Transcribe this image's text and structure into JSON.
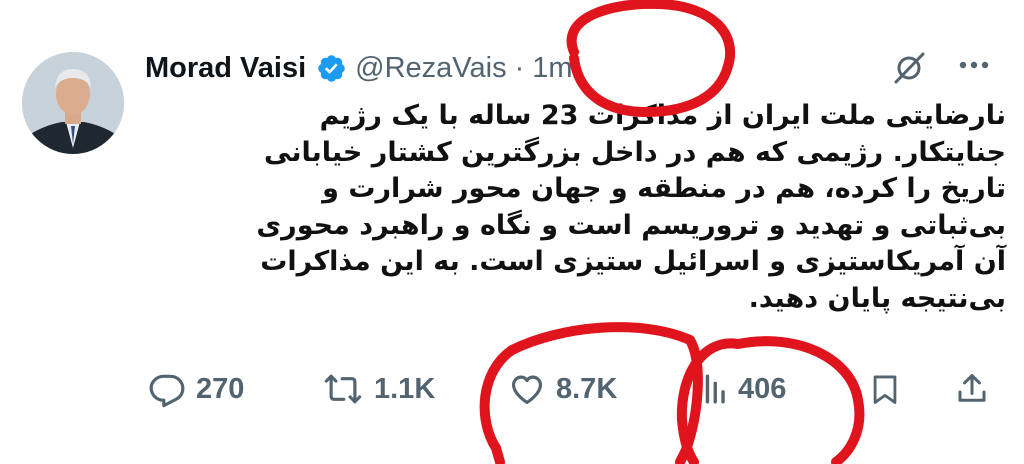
{
  "tweet": {
    "author_name": "Morad Vaisi",
    "handle": "@RezaVais",
    "separator": "·",
    "time": "1m",
    "text": "نارضایتی ملت ایران از مذاکرات 23 ساله با یک رژیم\nجنایتکار. رژیمی که هم در داخل بزرگترین کشتار خیابانی\nتاریخ را کرده، هم در منطقه و جهان محور شرارت و\nبی‌ثباتی و تهدید و تروریسم است و نگاه و راهبرد محوری\nآن آمریکاستیزی و اسرائیل ستیزی است. به این مذاکرات\nبی‌نتیجه پایان دهید."
  },
  "actions": {
    "replies": "270",
    "reposts": "1.1K",
    "likes": "8.7K",
    "views": "406"
  },
  "icons": {
    "verified": "verified-badge-icon",
    "grok": "grok-icon",
    "more": "more-icon",
    "reply": "reply-icon",
    "repost": "repost-icon",
    "like": "heart-icon",
    "views": "views-icon",
    "bookmark": "bookmark-icon",
    "share": "share-icon"
  },
  "colors": {
    "verified": "#1d9bf0",
    "secondary_text": "#536471",
    "annotation": "#e0141c"
  }
}
